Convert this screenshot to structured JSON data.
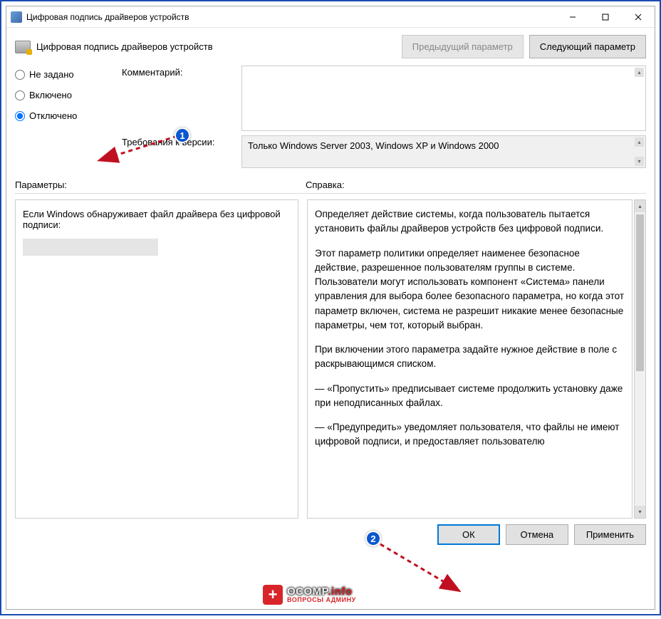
{
  "window": {
    "title": "Цифровая подпись драйверов устройств"
  },
  "header": {
    "policy_title": "Цифровая подпись драйверов устройств",
    "prev_btn": "Предыдущий параметр",
    "next_btn": "Следующий параметр"
  },
  "radios": {
    "not_configured": "Не задано",
    "enabled": "Включено",
    "disabled": "Отключено",
    "selected": "disabled"
  },
  "fields": {
    "comment_label": "Комментарий:",
    "requirements_label": "Требования к версии:",
    "requirements_value": "Только Windows Server 2003, Windows XP и Windows 2000"
  },
  "section_labels": {
    "params": "Параметры:",
    "help": "Справка:"
  },
  "params": {
    "text": "Если Windows обнаруживает файл драйвера без цифровой подписи:"
  },
  "help": {
    "p1": "Определяет действие системы, когда пользователь пытается установить файлы драйверов устройств без цифровой подписи.",
    "p2": "Этот параметр политики определяет наименее безопасное действие, разрешенное пользователям группы в системе. Пользователи могут использовать компонент «Система» панели управления для выбора более безопасного параметра, но когда этот параметр включен, система не разрешит никакие менее безопасные параметры, чем тот, который выбран.",
    "p3": "При включении этого параметра задайте нужное действие в поле с раскрывающимся списком.",
    "p4": "— «Пропустить» предписывает системе продолжить установку даже при неподписанных файлах.",
    "p5": "— «Предупредить» уведомляет пользователя, что файлы не имеют цифровой подписи, и предоставляет пользователю"
  },
  "buttons": {
    "ok": "ОК",
    "cancel": "Отмена",
    "apply": "Применить"
  },
  "annotations": {
    "badge1": "1",
    "badge2": "2"
  },
  "watermark": {
    "brand": "OCOMP",
    "suffix": ".info",
    "tagline": "ВОПРОСЫ АДМИНУ"
  }
}
